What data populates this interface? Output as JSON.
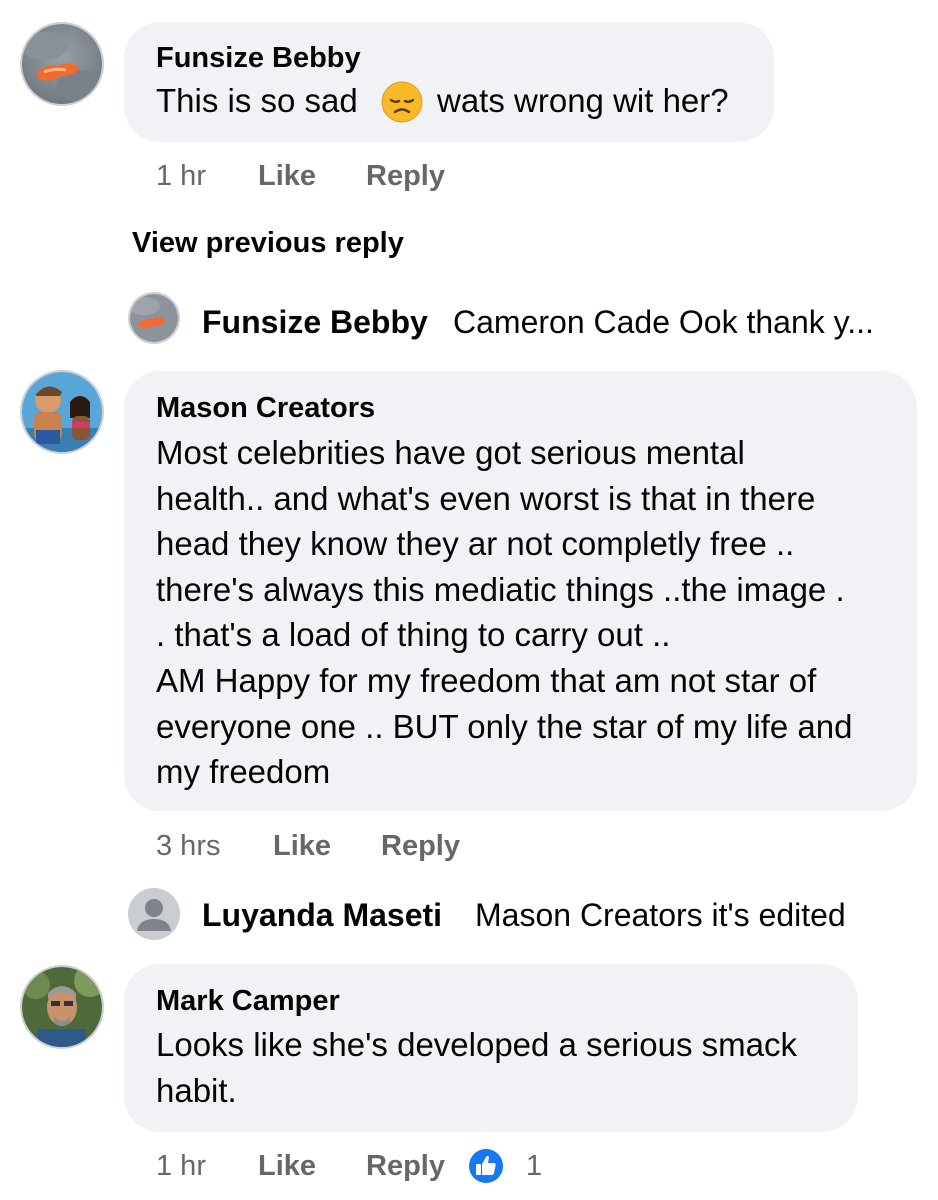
{
  "comments": [
    {
      "author": "Funsize Bebby",
      "text_before_emoji": "This is so sad",
      "emoji": "disappointed-face-emoji",
      "text_after_emoji": "wats wrong wit her?",
      "time": "1 hr",
      "like_label": "Like",
      "reply_label": "Reply"
    },
    {
      "author": "Mason Creators",
      "lines": [
        "Most celebrities have got serious mental",
        "health.. and what's even worst is that in there",
        "head they know they ar not completly free ..",
        "there's always this mediatic things ..the image .",
        ". that's  a load of thing to carry out ..",
        "AM Happy for my freedom that am not star of",
        "everyone one .. BUT only the star of my life and",
        "my freedom"
      ],
      "time": "3 hrs",
      "like_label": "Like",
      "reply_label": "Reply"
    },
    {
      "author": "Mark Camper",
      "lines": [
        "Looks like she's developed a serious smack",
        "habit."
      ],
      "time": "1 hr",
      "like_label": "Like",
      "reply_label": "Reply",
      "reaction_icon": "like-thumb-icon",
      "reaction_count": "1"
    }
  ],
  "view_previous_reply": "View previous reply",
  "replies": [
    {
      "author": "Funsize Bebby",
      "text": "Cameron Cade Ook thank y..."
    },
    {
      "author": "Luyanda Maseti",
      "text": "Mason Creators it's edited"
    }
  ],
  "colors": {
    "bubble": "#f0f2f5",
    "meta_text": "#65676b",
    "like_blue": "#1877f2",
    "emoji_yellow": "#f7b928"
  }
}
